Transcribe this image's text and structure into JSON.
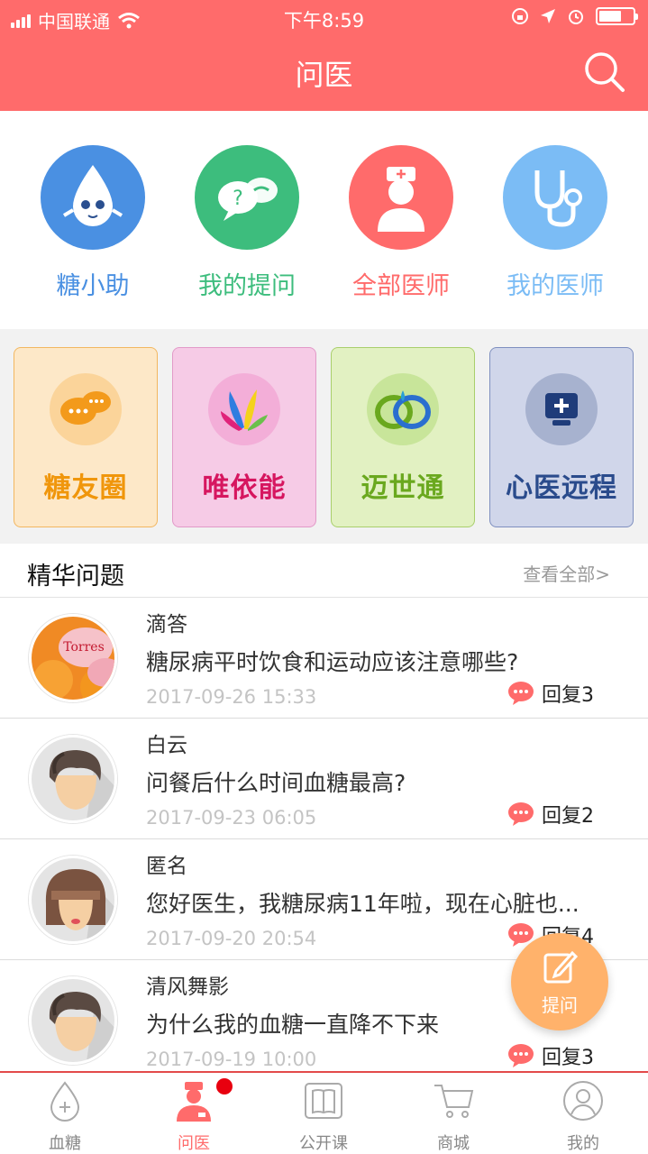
{
  "status_bar": {
    "carrier": "中国联通",
    "time": "下午8:59"
  },
  "nav": {
    "title": "问医"
  },
  "quick_entries": [
    {
      "label": "糖小助",
      "color": "#4a90e2",
      "icon": "water-drop-mascot-icon"
    },
    {
      "label": "我的提问",
      "color": "#3dbd7d",
      "icon": "question-bubbles-icon"
    },
    {
      "label": "全部医师",
      "color": "#ff6b6b",
      "icon": "nurse-icon"
    },
    {
      "label": "我的医师",
      "color": "#7bbcf5",
      "icon": "stethoscope-icon"
    }
  ],
  "partners": [
    {
      "name": "糖友圈",
      "text_color": "#f0960b",
      "bg": "#fde8c8",
      "border": "#f2b760",
      "icon": "chat-bubbles-icon"
    },
    {
      "name": "唯依能",
      "text_color": "#d6165f",
      "bg": "#f6cbe6",
      "border": "#e29ac8",
      "icon": "colorful-leaves-icon"
    },
    {
      "name": "迈世通",
      "text_color": "#6aa81e",
      "bg": "#e2f1c2",
      "border": "#a9cf6c",
      "icon": "heart-loop-icon"
    },
    {
      "name": "心医远程",
      "text_color": "#2a4b8c",
      "bg": "#d0d6ea",
      "border": "#7e8fbf",
      "icon": "medical-monitor-icon"
    }
  ],
  "section": {
    "title": "精华问题",
    "more": "查看全部>"
  },
  "questions": [
    {
      "name": "滴答",
      "question": "糖尿病平时饮食和运动应该注意哪些?",
      "date": "2017-09-26 15:33",
      "reply": "回复3",
      "avatar": "oranges-photo"
    },
    {
      "name": "白云",
      "question": "问餐后什么时间血糖最高?",
      "date": "2017-09-23 06:05",
      "reply": "回复2",
      "avatar": "male-avatar"
    },
    {
      "name": "匿名",
      "question": "您好医生，我糖尿病11年啦，现在心脏也...",
      "date": "2017-09-20 20:54",
      "reply": "回复4",
      "avatar": "female-avatar"
    },
    {
      "name": "清风舞影",
      "question": "为什么我的血糖一直降不下来",
      "date": "2017-09-19 10:00",
      "reply": "回复3",
      "avatar": "male-avatar"
    }
  ],
  "fab": {
    "label": "提问"
  },
  "tabs": [
    {
      "label": "血糖",
      "icon": "blood-drop-icon",
      "active": false
    },
    {
      "label": "问医",
      "icon": "doctor-icon",
      "active": true
    },
    {
      "label": "公开课",
      "icon": "book-icon",
      "active": false
    },
    {
      "label": "商城",
      "icon": "cart-icon",
      "active": false
    },
    {
      "label": "我的",
      "icon": "user-icon",
      "active": false
    }
  ],
  "colors": {
    "brand": "#ff6b6b",
    "fab": "#ffb26b",
    "reply_bubble": "#ff6b6b"
  }
}
